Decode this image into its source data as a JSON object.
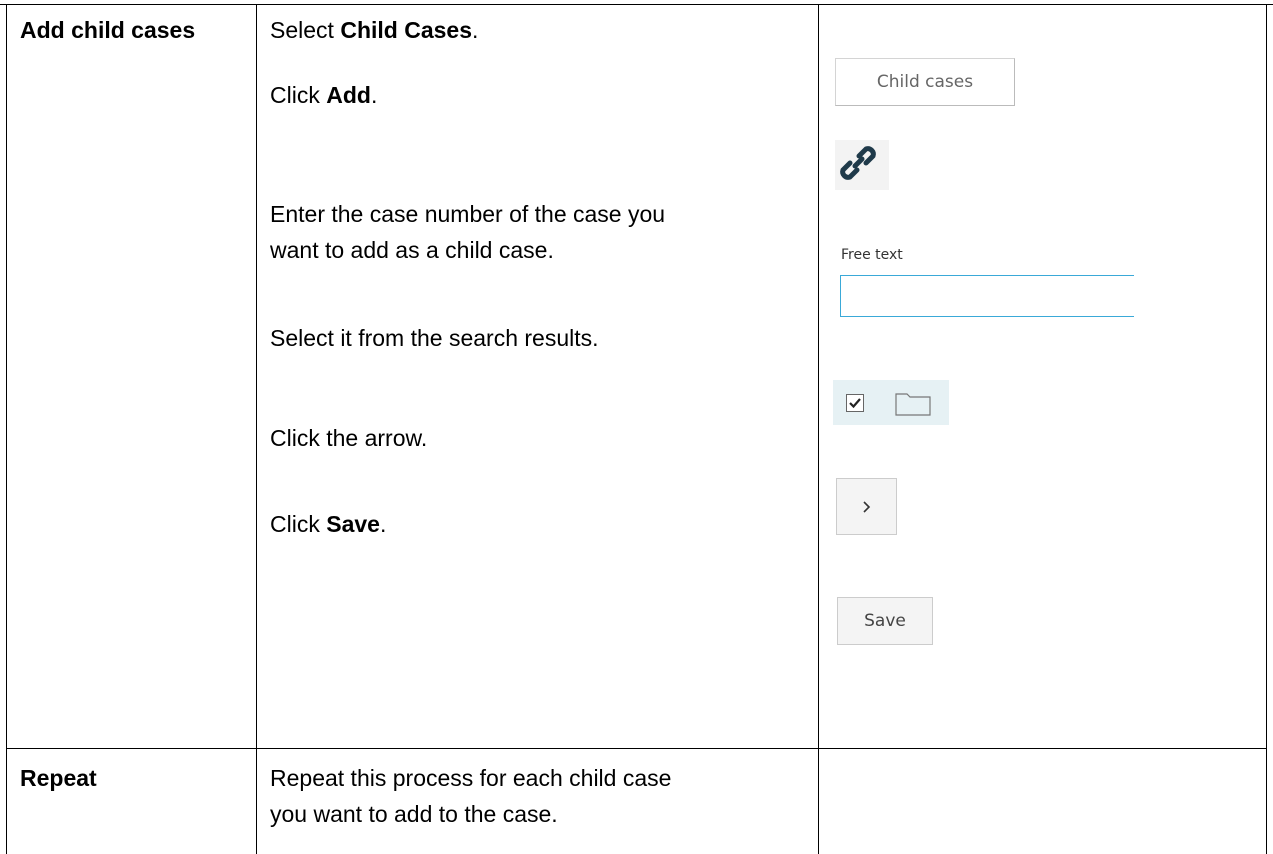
{
  "rows": [
    {
      "label": "Add child cases",
      "steps": [
        {
          "pre": "Select ",
          "bold": "Child Cases",
          "post": "."
        },
        {
          "pre": "Click ",
          "bold": "Add",
          "post": "."
        },
        {
          "line1": "Enter the case number of the case you",
          "line2": "want to add as a child case."
        },
        {
          "text": "Select it from the search results."
        },
        {
          "text": "Click the arrow."
        },
        {
          "pre": "Click ",
          "bold": "Save",
          "post": "."
        }
      ]
    },
    {
      "label": "Repeat",
      "text_line1": "Repeat this process for each child case",
      "text_line2": "you want to add to the case."
    }
  ],
  "illustrations": {
    "tab_label": "Child cases",
    "link_icon": "link-icon",
    "field_label": "Free text",
    "field_value": "",
    "result_row_icons": [
      "checkbox-checked-icon",
      "folder-icon"
    ],
    "arrow_icon": "chevron-right-icon",
    "save_label": "Save"
  },
  "colors": {
    "grid": "#000000",
    "input_border": "#3aa9d8",
    "link_icon": "#1f3a4a",
    "result_row_bg": "#e6f1f4"
  }
}
